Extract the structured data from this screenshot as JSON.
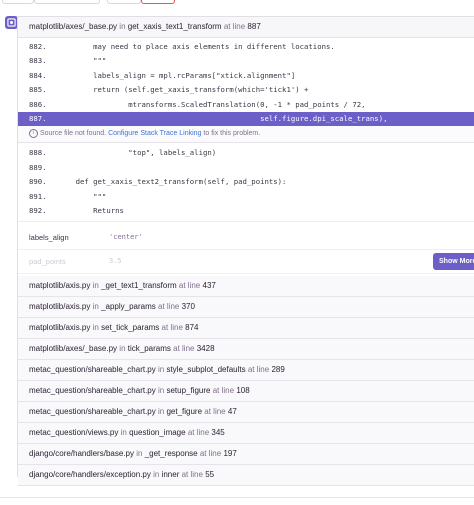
{
  "header_frame": {
    "file": "matplotlib/axes/_base.py",
    "in_text": "in",
    "function": "get_xaxis_text1_transform",
    "at_line_text": "at line",
    "line": "887"
  },
  "code_lines": [
    {
      "num": "882.",
      "code": "        may need to place axis elements in different locations."
    },
    {
      "num": "883.",
      "code": "        \"\"\""
    },
    {
      "num": "884.",
      "code": "        labels_align = mpl.rcParams[\"xtick.alignment\"]"
    },
    {
      "num": "885.",
      "code": "        return (self.get_xaxis_transform(which='tick1') +"
    },
    {
      "num": "886.",
      "code": "                mtransforms.ScaledTranslation(0, -1 * pad_points / 72,"
    },
    {
      "num": "887.",
      "code": "                                              self.figure.dpi_scale_trans),"
    }
  ],
  "notice": {
    "icon": "info-icon",
    "text": "Source file not found.",
    "link": "Configure Stack Trace Linking",
    "suffix": "to fix this problem."
  },
  "code_lines_after": [
    {
      "num": "888.",
      "code": "                \"top\", labels_align)"
    },
    {
      "num": "889.",
      "code": ""
    },
    {
      "num": "890.",
      "code": "    def get_xaxis_text2_transform(self, pad_points):"
    },
    {
      "num": "891.",
      "code": "        \"\"\""
    },
    {
      "num": "892.",
      "code": "        Returns"
    }
  ],
  "variables": [
    {
      "key": "labels_align",
      "value": "'center'"
    },
    {
      "key": "pad_points",
      "value": "3.5"
    }
  ],
  "show_more_label": "Show More",
  "frames": [
    {
      "file": "matplotlib/axis.py",
      "function": "_get_text1_transform",
      "line": "437"
    },
    {
      "file": "matplotlib/axis.py",
      "function": "_apply_params",
      "line": "370"
    },
    {
      "file": "matplotlib/axis.py",
      "function": "set_tick_params",
      "line": "874"
    },
    {
      "file": "matplotlib/axes/_base.py",
      "function": "tick_params",
      "line": "3428"
    },
    {
      "file": "metac_question/shareable_chart.py",
      "function": "style_subplot_defaults",
      "line": "289"
    },
    {
      "file": "metac_question/shareable_chart.py",
      "function": "setup_figure",
      "line": "108"
    },
    {
      "file": "metac_question/shareable_chart.py",
      "function": "get_figure",
      "line": "47"
    },
    {
      "file": "metac_question/views.py",
      "function": "question_image",
      "line": "345"
    },
    {
      "file": "django/core/handlers/base.py",
      "function": "_get_response",
      "line": "197"
    },
    {
      "file": "django/core/handlers/exception.py",
      "function": "inner",
      "line": "55"
    }
  ],
  "frame_in_text": "in",
  "frame_at_line_text": "at line",
  "colors": {
    "accent": "#6c5fc7",
    "link": "#3d74db",
    "danger": "#e0575a"
  }
}
